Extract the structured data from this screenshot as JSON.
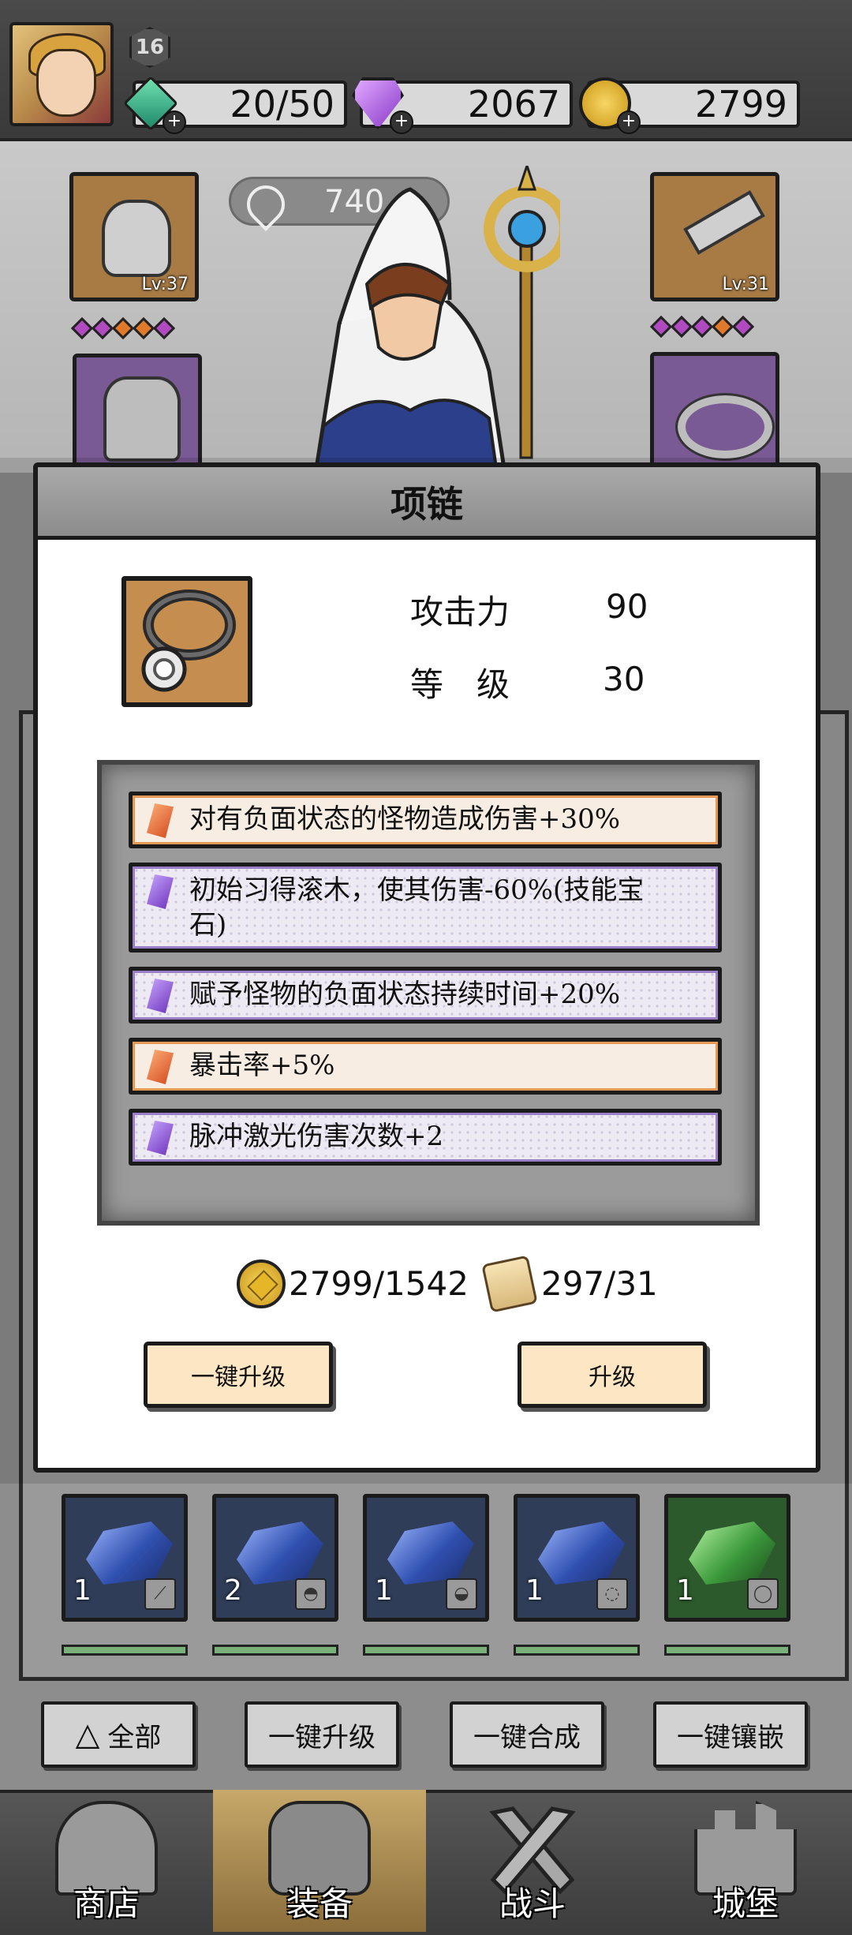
{
  "player": {
    "level": "16",
    "energy": "20/50",
    "gems": "2067",
    "coins": "2799",
    "plus": "+"
  },
  "hero": {
    "power": "740",
    "left_top_slot_level": "Lv:37",
    "right_top_slot_level": "Lv:31"
  },
  "modal": {
    "title": "项链",
    "stats": [
      {
        "label": "攻击力",
        "value": "90"
      },
      {
        "label": "等　级",
        "value": "30"
      }
    ],
    "affixes": [
      {
        "text": "对有负面状态的怪物造成伤害+30%",
        "kind": "orange"
      },
      {
        "text": "初始习得滚木，使其伤害-60%(技能宝石)",
        "kind": "purple"
      },
      {
        "text": "赋予怪物的负面状态持续时间+20%",
        "kind": "purple"
      },
      {
        "text": "暴击率+5%",
        "kind": "orange"
      },
      {
        "text": "脉冲激光伤害次数+2",
        "kind": "purple"
      }
    ],
    "cost_coins": "2799/1542",
    "cost_scrolls": "297/31",
    "btn_one_key_upgrade": "一键升级",
    "btn_upgrade": "升级"
  },
  "gem_slots": [
    {
      "count": "1",
      "color": "blue",
      "type_icon": "wand-icon"
    },
    {
      "count": "2",
      "color": "blue",
      "type_icon": "armor-icon"
    },
    {
      "count": "1",
      "color": "blue",
      "type_icon": "helmet-icon"
    },
    {
      "count": "1",
      "color": "blue",
      "type_icon": "necklace-icon"
    },
    {
      "count": "1",
      "color": "green",
      "type_icon": "ring-icon"
    }
  ],
  "actions": {
    "filter_all": "全部",
    "one_key_upgrade": "一键升级",
    "one_key_merge": "一键合成",
    "one_key_inlay": "一键镶嵌"
  },
  "nav": {
    "shop": "商店",
    "equipment": "装备",
    "battle": "战斗",
    "castle": "城堡"
  },
  "colors": {
    "orange_affix": "#e49a55",
    "purple_affix": "#9a7ec8",
    "cream_button": "#fde6c3"
  }
}
